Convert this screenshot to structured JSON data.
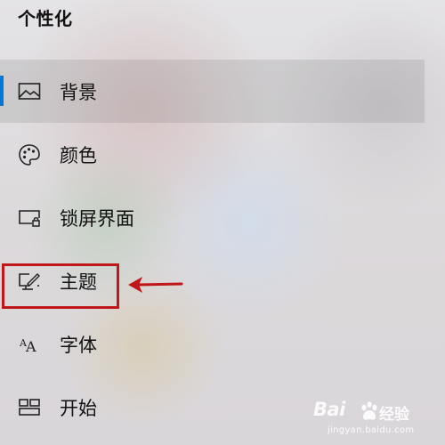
{
  "header": {
    "title": "个性化"
  },
  "nav": {
    "items": [
      {
        "label": "背景",
        "icon": "picture-icon",
        "selected": true
      },
      {
        "label": "颜色",
        "icon": "palette-icon",
        "selected": false
      },
      {
        "label": "锁屏界面",
        "icon": "lock-screen-icon",
        "selected": false
      },
      {
        "label": "主题",
        "icon": "theme-icon",
        "selected": false
      },
      {
        "label": "字体",
        "icon": "font-icon",
        "selected": false
      },
      {
        "label": "开始",
        "icon": "start-icon",
        "selected": false
      }
    ]
  },
  "annotation": {
    "highlighted_item": "主题",
    "color": "#c0171b"
  },
  "watermark": {
    "brand": "Bai",
    "site": "经验",
    "url": "jingyan.baidu.com"
  },
  "colors": {
    "accent": "#0078d7",
    "text": "#111111"
  }
}
